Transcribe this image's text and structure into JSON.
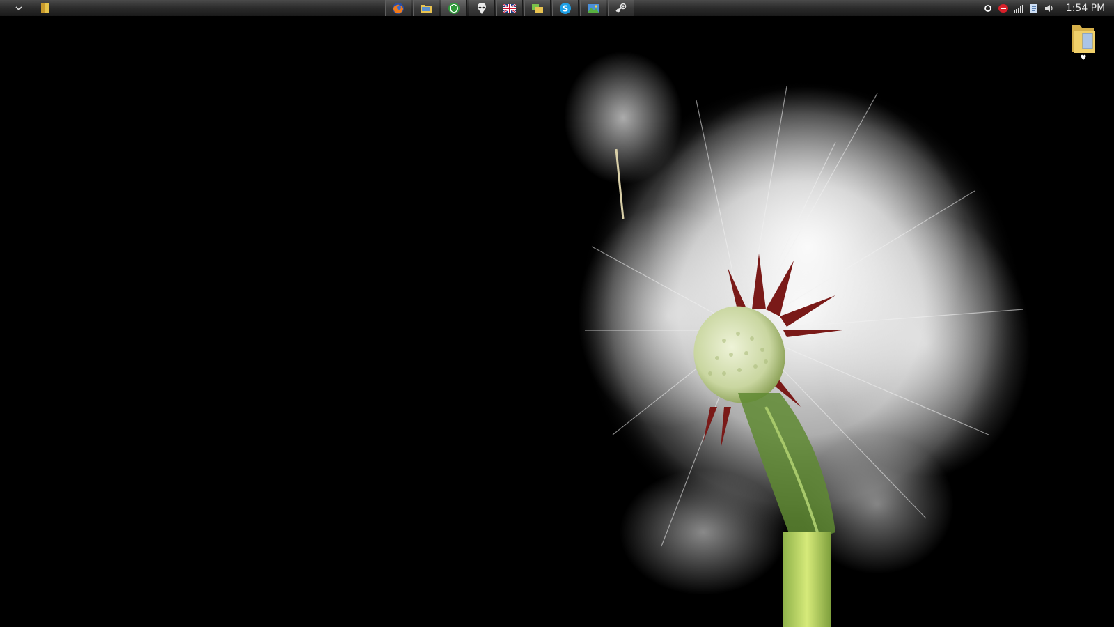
{
  "taskbar": {
    "menu_icon": "chevron-down-icon",
    "quick_launch_icon": "folder-icon",
    "tasks": [
      {
        "icon": "firefox-icon"
      },
      {
        "icon": "file-explorer-icon"
      },
      {
        "icon": "utorrent-icon"
      },
      {
        "icon": "alien-icon"
      },
      {
        "icon": "uk-flag-icon"
      },
      {
        "icon": "copy-icon"
      },
      {
        "icon": "skype-icon"
      },
      {
        "icon": "landscape-icon"
      },
      {
        "icon": "steam-icon"
      }
    ],
    "tray": [
      {
        "icon": "circle-icon"
      },
      {
        "icon": "red-tray-icon"
      },
      {
        "icon": "signal-bars-icon"
      },
      {
        "icon": "document-icon"
      },
      {
        "icon": "speaker-icon"
      }
    ],
    "clock": "1:54 PM"
  },
  "desktop": {
    "wallpaper": "dandelion-seed-head",
    "icons": [
      {
        "icon": "folder-icon",
        "label": "♥"
      }
    ]
  },
  "colors": {
    "taskbar_top": "#4a4a4a",
    "taskbar_bottom": "#1a1a1a",
    "desktop_bg": "#000000",
    "clock_text": "#e8e8e8"
  }
}
